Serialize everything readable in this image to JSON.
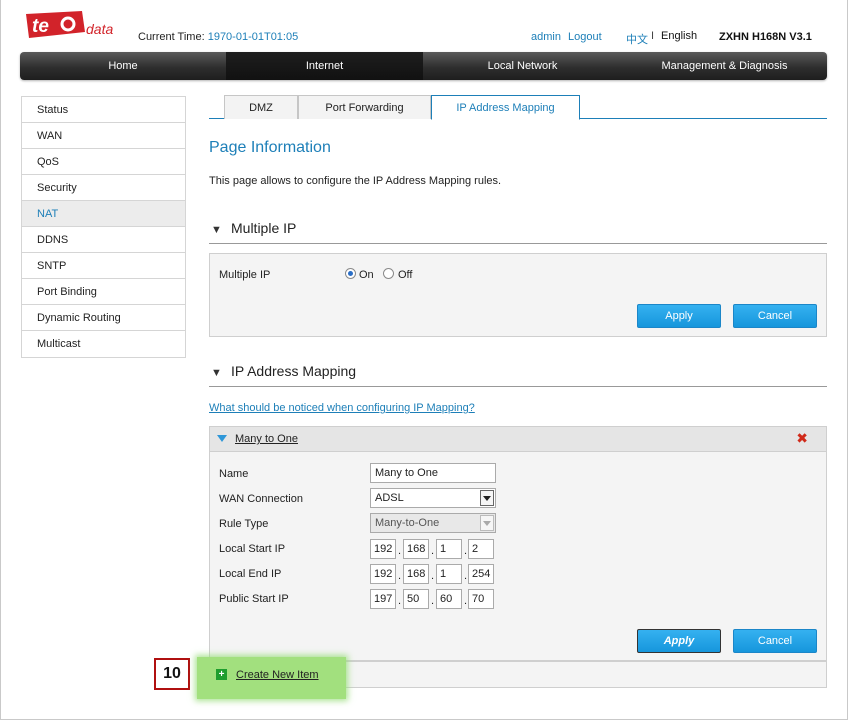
{
  "header": {
    "logo_text": "te data",
    "current_time_label": "Current Time:",
    "current_time_value": "1970-01-01T01:05",
    "user": "admin",
    "logout": "Logout",
    "lang_cn": "中文",
    "lang_sep": "I",
    "lang_en": "English",
    "model": "ZXHN H168N V3.1"
  },
  "topnav": [
    "Home",
    "Internet",
    "Local Network",
    "Management & Diagnosis"
  ],
  "leftmenu": [
    "Status",
    "WAN",
    "QoS",
    "Security",
    "NAT",
    "DDNS",
    "SNTP",
    "Port Binding",
    "Dynamic Routing",
    "Multicast"
  ],
  "subtabs": [
    "DMZ",
    "Port Forwarding",
    "IP Address Mapping"
  ],
  "page": {
    "title": "Page Information",
    "description": "This page allows to configure the IP Address Mapping rules."
  },
  "multiple_ip": {
    "section_title": "Multiple IP",
    "field_label": "Multiple IP",
    "option_on": "On",
    "option_off": "Off",
    "selected": "On",
    "apply": "Apply",
    "cancel": "Cancel"
  },
  "mapping": {
    "section_title": "IP Address Mapping",
    "help_link": "What should be noticed when configuring IP Mapping?",
    "item_title": "Many to One",
    "fields": {
      "name_label": "Name",
      "name_value": "Many to One",
      "wan_label": "WAN Connection",
      "wan_value": "ADSL",
      "rule_label": "Rule Type",
      "rule_value": "Many-to-One",
      "local_start_label": "Local Start IP",
      "local_start": [
        "192",
        "168",
        "1",
        "2"
      ],
      "local_end_label": "Local End IP",
      "local_end": [
        "192",
        "168",
        "1",
        "254"
      ],
      "public_start_label": "Public Start IP",
      "public_start": [
        "197",
        "50",
        "60",
        "70"
      ]
    },
    "apply": "Apply",
    "cancel": "Cancel",
    "create_new": "Create New Item"
  },
  "callout": "10",
  "colors": {
    "accent": "#1d7fb8",
    "button": "#1696dc",
    "delete": "#d02a1a",
    "highlight": "#a2e07e",
    "callout_border": "#b01010"
  }
}
